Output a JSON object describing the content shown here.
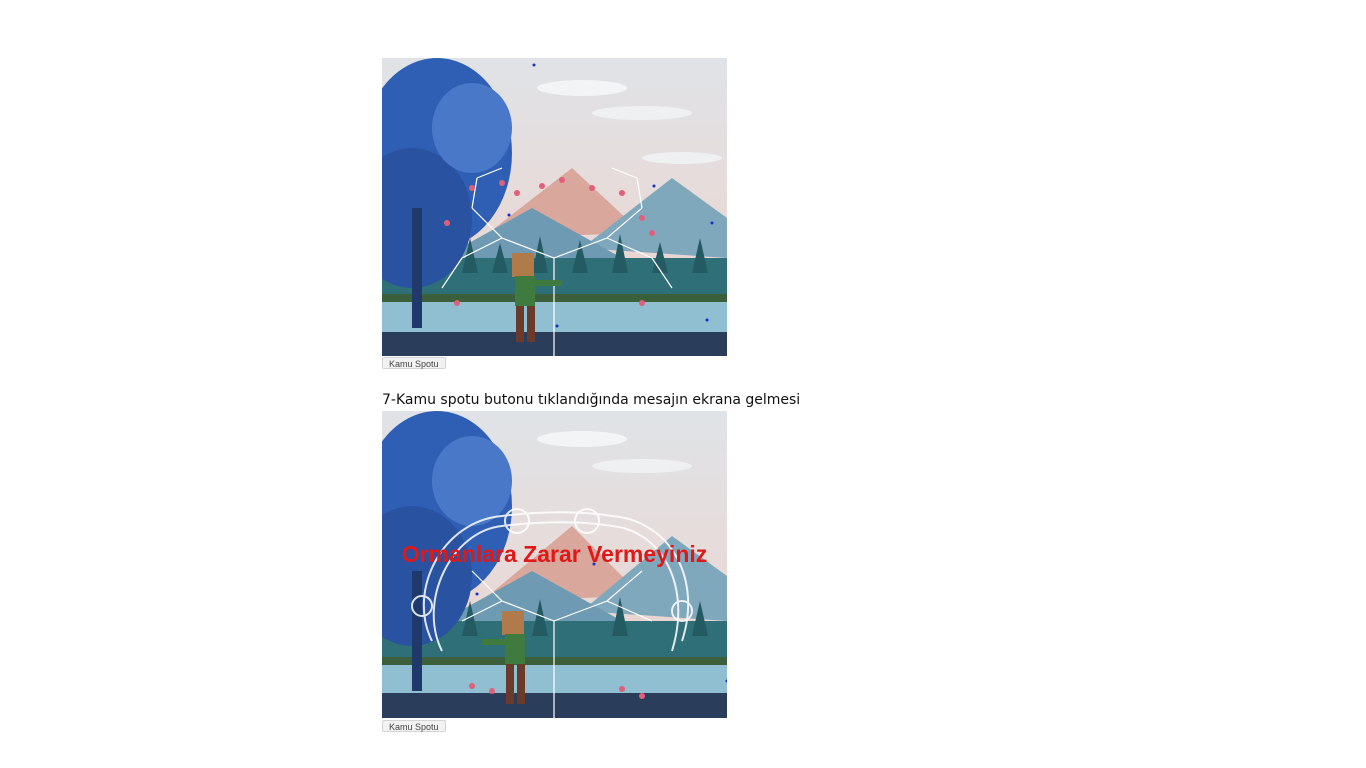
{
  "scene1": {
    "button_label": "Kamu Spotu"
  },
  "caption": "7-Kamu spotu butonu tıklandığında mesajın ekrana gelmesi",
  "scene2": {
    "message": "Ormanlara Zarar Vermeyiniz",
    "button_label": "Kamu Spotu"
  },
  "colors": {
    "message": "#e01818",
    "sky": "#e3e6ea",
    "tree_blue": "#2f5fb5",
    "water": "#7fb2c8"
  }
}
